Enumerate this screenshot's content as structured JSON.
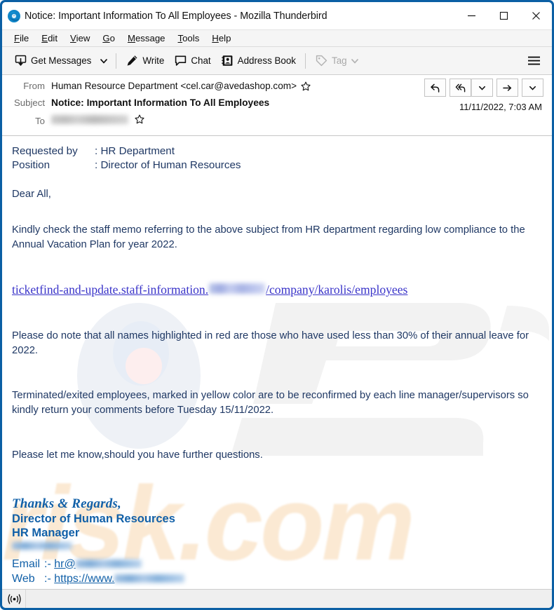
{
  "window": {
    "title": "Notice: Important Information To All Employees - Mozilla Thunderbird",
    "app_icon": "thunderbird-logo-icon",
    "controls": {
      "minimize": "minimize-icon",
      "maximize": "maximize-icon",
      "close": "close-icon"
    },
    "border_color": "#0b5fa4"
  },
  "menubar": {
    "items": [
      {
        "label": "File",
        "accesskey": "F"
      },
      {
        "label": "Edit",
        "accesskey": "E"
      },
      {
        "label": "View",
        "accesskey": "V"
      },
      {
        "label": "Go",
        "accesskey": "G"
      },
      {
        "label": "Message",
        "accesskey": "M"
      },
      {
        "label": "Tools",
        "accesskey": "T"
      },
      {
        "label": "Help",
        "accesskey": "H"
      }
    ]
  },
  "toolbar": {
    "get_messages": "Get Messages",
    "get_messages_icon": "download-inbox-icon",
    "get_messages_chevron": "chevron-down-icon",
    "write": "Write",
    "write_icon": "pencil-icon",
    "chat": "Chat",
    "chat_icon": "speech-bubble-icon",
    "address_book": "Address Book",
    "address_book_icon": "contact-card-icon",
    "tag": "Tag",
    "tag_icon": "tag-icon",
    "tag_chevron": "chevron-down-icon",
    "tag_disabled": true,
    "app_menu_icon": "hamburger-menu-icon"
  },
  "message_header": {
    "from_label": "From",
    "from_value": "Human Resource Department <cel.car@avedashop.com>",
    "subject_label": "Subject",
    "subject_value": "Notice: Important Information To All Employees",
    "to_label": "To",
    "to_value_redacted": true,
    "date": "11/11/2022, 7:03 AM",
    "star_icon": "star-outline-icon",
    "actions": [
      {
        "name": "reply-button",
        "icon": "reply-arrow-icon"
      },
      {
        "name": "reply-all-button",
        "icon": "reply-all-arrow-icon"
      },
      {
        "name": "reply-menu-button",
        "icon": "chevron-down-icon"
      },
      {
        "name": "forward-button",
        "icon": "forward-arrow-icon"
      },
      {
        "name": "more-actions-button",
        "icon": "chevron-down-icon"
      }
    ]
  },
  "body": {
    "meta": [
      {
        "key": "Requested by",
        "sep": ": ",
        "value": "HR Department"
      },
      {
        "key": "Position",
        "sep": ": ",
        "value": "Director of Human Resources"
      }
    ],
    "greeting": "Dear All,",
    "paragraph_1": "Kindly check the staff memo referring to the above subject from HR department regarding low compliance to the Annual Vacation Plan for year 2022.",
    "link": {
      "prefix": "ticketfind-and-update.staff-information.",
      "redacted_domain": true,
      "suffix": "/company/karolis/employees"
    },
    "paragraph_2": "Please do note that all names highlighted in red are those who have used less than 30% of their annual leave for 2022.",
    "paragraph_3": "Terminated/exited employees, marked in yellow color are to be reconfirmed by each line manager/supervisors so kindly return your comments before Tuesday 15/11/2022.",
    "paragraph_4": "Please let me know,should you have further questions.",
    "watermark_pc": "PC",
    "watermark_risk": "risk.com"
  },
  "signature": {
    "thanks": "Thanks & Regards,",
    "title": "Director of Human Resources",
    "role": "HR Manager",
    "company_redacted": true,
    "email_label": "Email",
    "email_sep": ":- ",
    "email_value": "hr@",
    "email_domain_redacted": true,
    "web_label": "Web",
    "web_sep": ":- ",
    "web_value": "https://www.",
    "web_domain_redacted": true
  },
  "statusbar": {
    "online_icon": "online-broadcast-icon"
  },
  "colors": {
    "window_border": "#0b5fa4",
    "body_text": "#1f3864",
    "link": "#3a34c9",
    "signature": "#1160a8",
    "toolbar_bg": "#f5f5f5"
  }
}
